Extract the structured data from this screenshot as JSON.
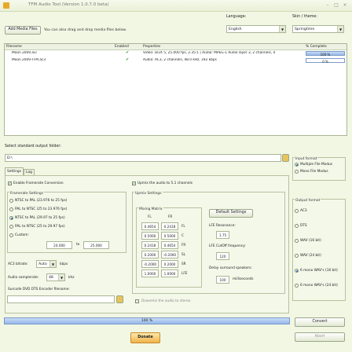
{
  "window": {
    "title": "TFM Audio Tool   (Version 1.0.7.0 beta)"
  },
  "top": {
    "add_button": "Add Media Files",
    "drag_hint": "You can also drag and drop media files below.",
    "language_label": "Language:",
    "language_value": "English",
    "skin_label": "Skin / theme:",
    "skin_value": "Springtime"
  },
  "files": {
    "headers": [
      "Filename",
      "Enabled",
      "Properties",
      "% Complete"
    ],
    "rows": [
      {
        "filename": "Moon 2009.avi",
        "properties": "Video: DivX 5, 25.000 fps, 2.35:1 | Audio: MPEG-1 Audio layer 3, 2 channels, 4",
        "percent": "100 %",
        "progress": 1.0
      },
      {
        "filename": "Moon 2009-TFM.ac3",
        "properties": "Audio: AC3, 2 channels, 48.0 kHz, 192 kbps",
        "percent": "0 %",
        "progress": 0.0
      }
    ]
  },
  "output_folder": {
    "label": "Select standard output folder:",
    "value": "D:\\"
  },
  "tabs": [
    "Settings",
    "Log"
  ],
  "framerate": {
    "enable_label": "Enable Framerate Conversion",
    "title": "Framerate Settings",
    "options": [
      "NTSC to PAL (23.976 to 25 fps)",
      "PAL to NTSC (25 to 23.976 fps)",
      "NTSC to PAL (29.97 to 25 fps)",
      "PAL to NTSC (25 to 29.97 fps)",
      "Custom:"
    ],
    "selected_index": 2,
    "custom_from": "24.000",
    "custom_to_label": "to",
    "custom_to": "25.000"
  },
  "ac3": {
    "bitrate_label": "AC3 bitrate:",
    "bitrate_value": "Auto",
    "bitrate_unit": "kbps",
    "samplerate_label": "Audio samplerate:",
    "samplerate_value": "48",
    "samplerate_unit": "khz"
  },
  "surcode": {
    "label": "Surcode DVD DTS Encoder filename:",
    "value": ""
  },
  "upmix": {
    "enable_label": "Upmix the audio to 5.1 channels",
    "title": "Upmix Settings",
    "matrix_title": "Mixing Matrix",
    "col_headers": [
      "FL",
      "FR"
    ],
    "rows": [
      {
        "fl": "0.4654",
        "fr": "0.2418",
        "ch": "FL"
      },
      {
        "fl": "0.5000",
        "fr": "0.5000",
        "ch": "C"
      },
      {
        "fl": "0.2418",
        "fr": "0.4654",
        "ch": "FR"
      },
      {
        "fl": "0.2000",
        "fr": "-0.2000",
        "ch": "SL"
      },
      {
        "fl": "-0.2000",
        "fr": "0.2000",
        "ch": "SR"
      },
      {
        "fl": "1.0000",
        "fr": "1.0000",
        "ch": "LFE"
      }
    ],
    "default_button": "Default Settings",
    "lfe_res_label": "LFE Resonance:",
    "lfe_res_value": "1.75",
    "lfe_cutoff_label": "LFE CutOff frequency:",
    "lfe_cutoff_value": "120",
    "delay_label": "Delay surround speakers:",
    "delay_value": "100",
    "delay_unit": "milliseconds",
    "downmix_label": "Downmix the audio to stereo"
  },
  "input_format": {
    "title": "Input format",
    "options": [
      "Multiple File Modus",
      "Mono File Modus"
    ],
    "selected_index": 0
  },
  "output_format": {
    "title": "Output format",
    "options": [
      "AC3",
      "DTS",
      "WAV (16 bit)",
      "WAV (24 bit)",
      "6 mono WAV's (16 bit)",
      "6 mono WAV's (24 bit)"
    ],
    "selected_index": 4
  },
  "bottom": {
    "progress_text": "100 %",
    "progress": 1.0,
    "convert_button": "Convert",
    "abort_button": "Abort",
    "donate_button": "Donate"
  },
  "colors": {
    "accent": "#e8a92a",
    "progress": "#96b7e8",
    "background": "#f2f7e4"
  }
}
